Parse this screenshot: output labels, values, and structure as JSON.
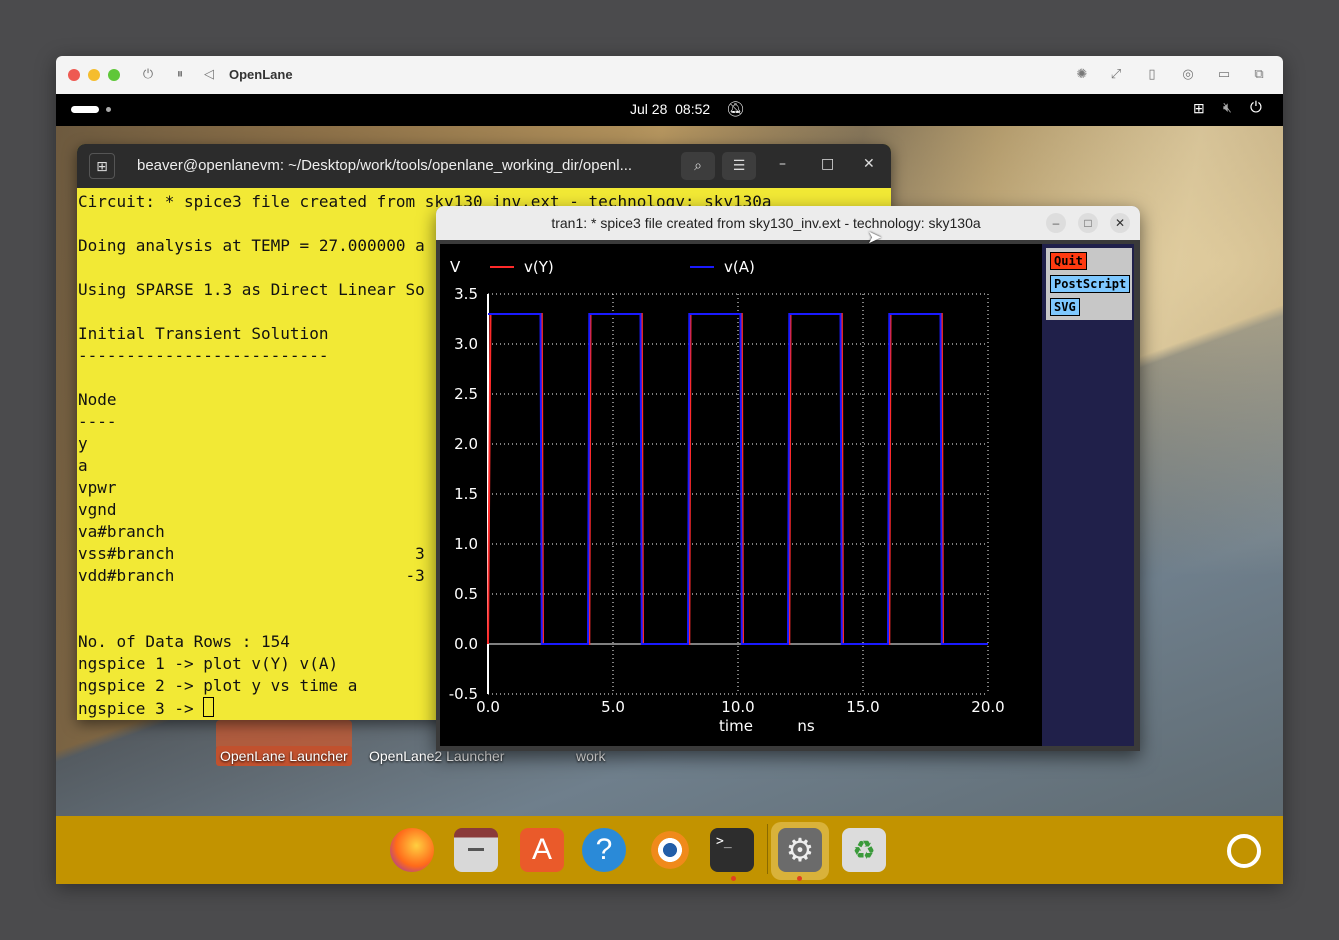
{
  "host": {
    "title": "OpenLane",
    "colors": {
      "close": "#ee5a52",
      "min": "#f5bd2e",
      "max": "#5fc739"
    }
  },
  "topbar": {
    "clock": "Jul 28  08:52"
  },
  "terminal": {
    "title": "beaver@openlanevm: ~/Desktop/work/tools/openlane_working_dir/openl...",
    "lines": [
      "Circuit: * spice3 file created from sky130_inv.ext - technology: sky130a",
      "",
      "Doing analysis at TEMP = 27.000000 a",
      "",
      "Using SPARSE 1.3 as Direct Linear So",
      "",
      "Initial Transient Solution",
      "--------------------------",
      "",
      "Node",
      "----",
      "y",
      "a",
      "vpwr",
      "vgnd",
      "va#branch",
      "vss#branch                         3",
      "vdd#branch                        -3",
      "",
      "",
      "No. of Data Rows : 154",
      "ngspice 1 -> plot v(Y) v(A)",
      "ngspice 2 -> plot y vs time a",
      "ngspice 3 -> "
    ]
  },
  "plot_window": {
    "title": "tran1: * spice3 file created from sky130_inv.ext - technology: sky130a",
    "buttons": {
      "quit": "Quit",
      "postscript": "PostScript",
      "svg": "SVG"
    }
  },
  "desktop_icons": [
    "OpenLane Launcher",
    "OpenLane2 Launcher",
    "work"
  ],
  "dock": [
    "firefox-icon",
    "files-icon",
    "app-center-icon",
    "help-icon",
    "blender-icon",
    "terminal-icon",
    "settings-icon",
    "trash-icon"
  ],
  "chart_data": {
    "type": "line",
    "xlabel": "time",
    "xunit": "ns",
    "ylabel": "V",
    "xlim": [
      0,
      20
    ],
    "ylim": [
      -0.5,
      3.5
    ],
    "xticks": [
      "0.0",
      "5.0",
      "10.0",
      "15.0",
      "20.0"
    ],
    "yticks": [
      "3.5",
      "3.0",
      "2.5",
      "2.0",
      "1.5",
      "1.0",
      "0.5",
      "0.0",
      "-0.5"
    ],
    "grid": true,
    "series": [
      {
        "name": "v(Y)",
        "color": "#ff2a2a",
        "x": [
          0.0,
          0.1,
          2.15,
          2.2,
          4.05,
          4.1,
          6.15,
          6.2,
          8.05,
          8.1,
          10.15,
          10.2,
          12.05,
          12.1,
          14.15,
          14.2,
          16.05,
          16.1,
          18.15,
          18.2,
          20.0
        ],
        "y": [
          0.0,
          3.3,
          3.3,
          0.0,
          0.0,
          3.3,
          3.3,
          0.0,
          0.0,
          3.3,
          3.3,
          0.0,
          0.0,
          3.3,
          3.3,
          0.0,
          0.0,
          3.3,
          3.3,
          0.0,
          0.0
        ]
      },
      {
        "name": "v(A)",
        "color": "#1a1aff",
        "x": [
          0.0,
          0.05,
          2.1,
          2.15,
          4.0,
          4.05,
          6.1,
          6.15,
          8.0,
          8.05,
          10.1,
          10.15,
          12.0,
          12.05,
          14.1,
          14.15,
          16.0,
          16.05,
          18.1,
          18.15,
          20.0
        ],
        "y": [
          3.3,
          3.3,
          3.3,
          0.0,
          0.0,
          3.3,
          3.3,
          0.0,
          0.0,
          3.3,
          3.3,
          0.0,
          0.0,
          3.3,
          3.3,
          0.0,
          0.0,
          3.3,
          3.3,
          0.0,
          0.0
        ]
      }
    ]
  }
}
